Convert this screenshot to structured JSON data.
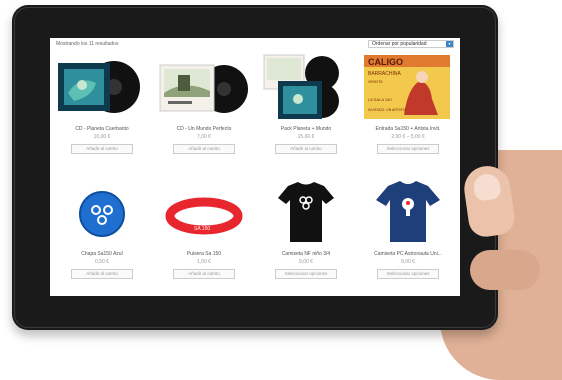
{
  "shop": {
    "results_text": "Mostrando los 11 resultados",
    "sort_label": "Ordenar por popularidad",
    "sort_button": "▾"
  },
  "products": [
    {
      "name": "CD - Planeta Cuerbanto",
      "price": "10,00 €",
      "button": "Añadir al carrito"
    },
    {
      "name": "CD - Un Mundo Perfecto",
      "price": "7,00 €",
      "button": "Añadir al carrito"
    },
    {
      "name": "Pack Planeta + Mundo",
      "price": "15,00 €",
      "button": "Añadir al carrito"
    },
    {
      "name": "Entrada Sa150 + Artista Invit.",
      "price": "2,00 € – 5,00 €",
      "button": "Seleccionar opciones"
    },
    {
      "name": "Chapa Sa150 Azul",
      "price": "0,50 €",
      "button": "Añadir al carrito"
    },
    {
      "name": "Pulsera Sa 150",
      "price": "1,50 €",
      "button": "Añadir al carrito"
    },
    {
      "name": "Camiseta NF niño 3/4",
      "price": "9,00 €",
      "button": "Seleccionar opciones"
    },
    {
      "name": "Camiseta PC Astronauta Uni...",
      "price": "9,00 €",
      "button": "Seleccionar opciones"
    }
  ],
  "poster_text": {
    "title": "CALIGO",
    "subtitle": "BARRACHINA",
    "line3": "GRATIS",
    "line4": "LA SALA 150",
    "line5": "INVITADO: UN ARTISTA"
  },
  "bracelet_text": "SA 150"
}
